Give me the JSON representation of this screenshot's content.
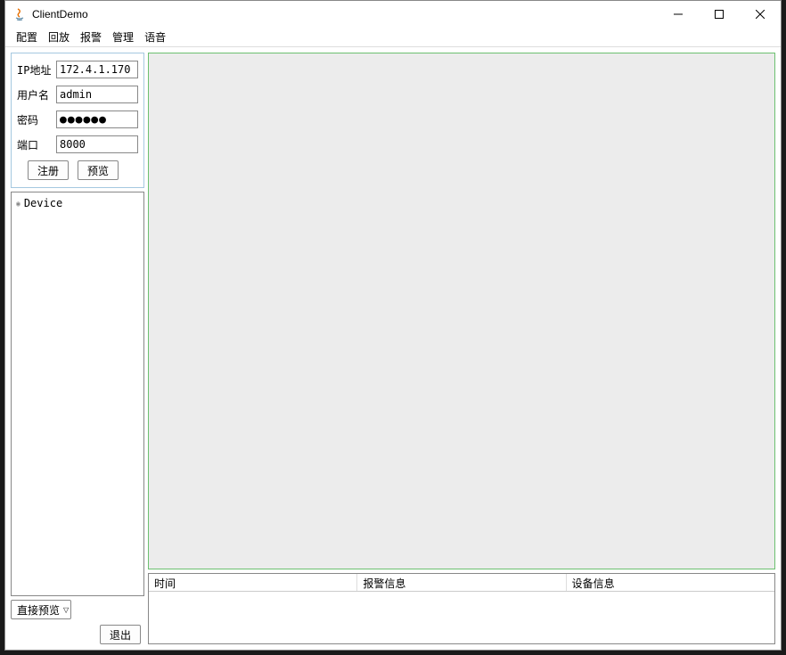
{
  "window": {
    "title": "ClientDemo"
  },
  "menubar": {
    "items": [
      {
        "label": "配置"
      },
      {
        "label": "回放"
      },
      {
        "label": "报警"
      },
      {
        "label": "管理"
      },
      {
        "label": "语音"
      }
    ]
  },
  "form": {
    "ip_label": "IP地址",
    "ip_value": "172.4.1.170",
    "user_label": "用户名",
    "user_value": "admin",
    "pwd_label": "密码",
    "pwd_value": "●●●●●●",
    "port_label": "端口",
    "port_value": "8000",
    "register_btn": "注册",
    "preview_btn": "预览"
  },
  "tree": {
    "root": "Device"
  },
  "bottom": {
    "combo_value": "直接预览",
    "exit_btn": "退出"
  },
  "table": {
    "columns": [
      {
        "label": "时间"
      },
      {
        "label": "报警信息"
      },
      {
        "label": "设备信息"
      }
    ]
  }
}
